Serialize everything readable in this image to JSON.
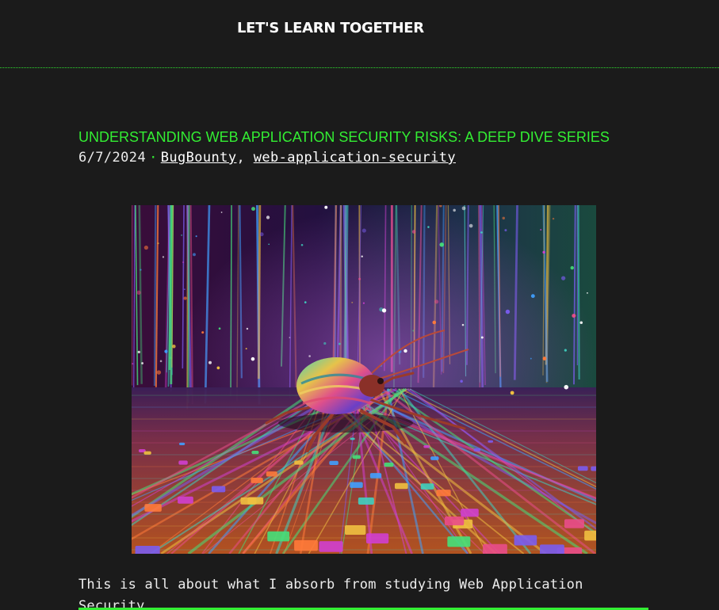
{
  "site": {
    "title": "LET'S LEARN TOGETHER"
  },
  "post": {
    "title": "UNDERSTANDING WEB APPLICATION SECURITY RISKS: A DEEP DIVE SERIES",
    "date": "6/7/2024",
    "separator": "·",
    "tags": [
      "BugBounty",
      "web-application-security"
    ],
    "tag_joiner": ",",
    "excerpt": "This is all about what I absorb from studying Web Application Security."
  },
  "colors": {
    "background": "#1b1b1b",
    "accent": "#33ee33",
    "text": "#ececec"
  }
}
